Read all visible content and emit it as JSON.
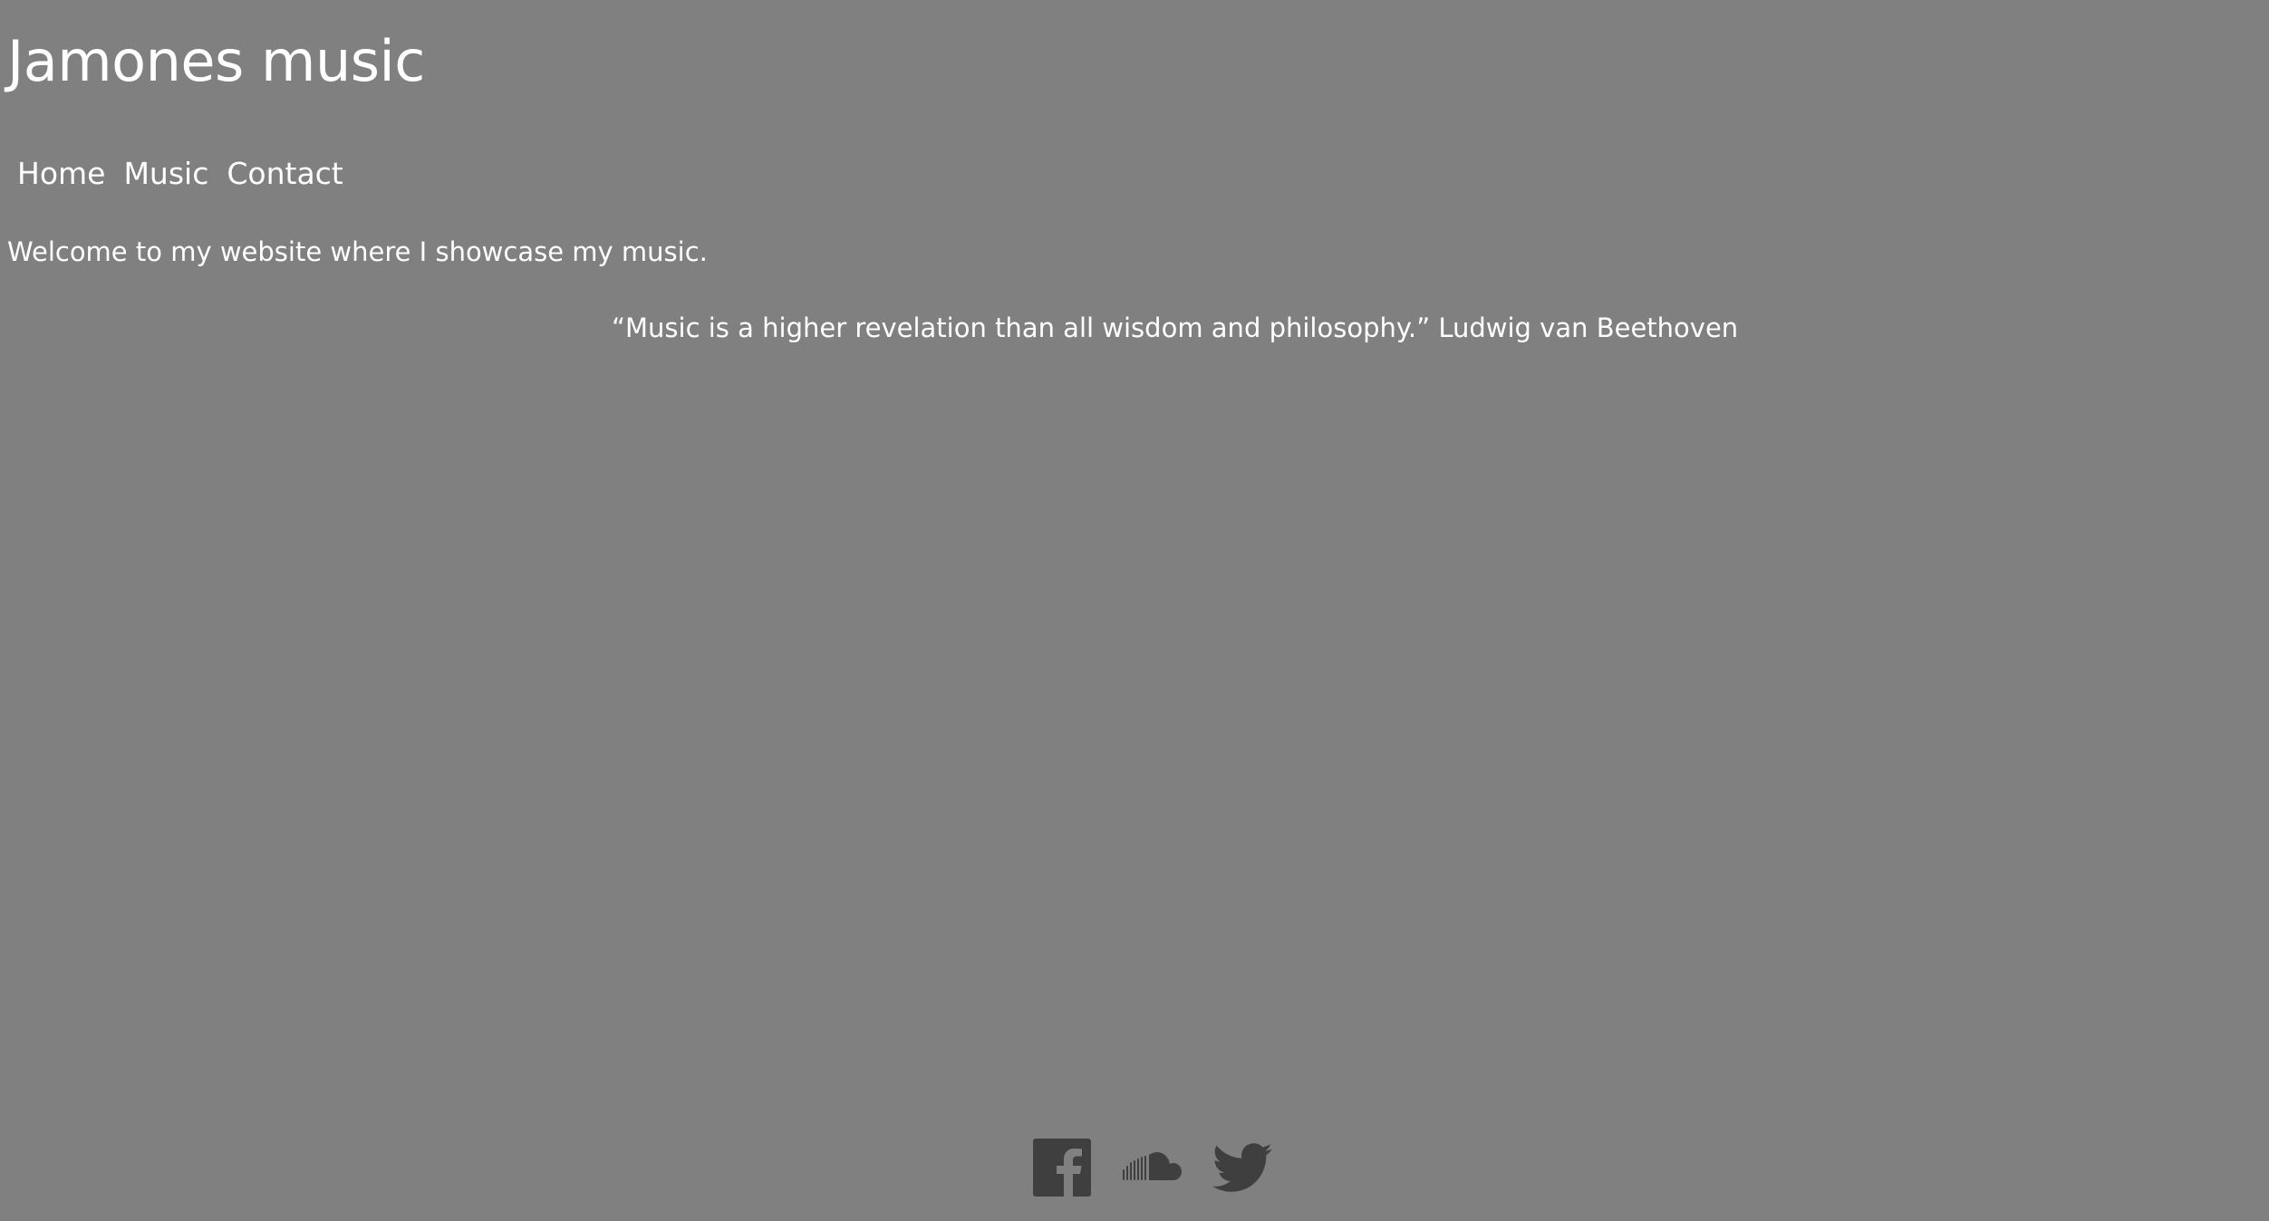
{
  "site": {
    "title": "Jamones music"
  },
  "nav": {
    "items": [
      {
        "label": "Home"
      },
      {
        "label": "Music"
      },
      {
        "label": "Contact"
      }
    ]
  },
  "content": {
    "welcome": "Welcome to my website where I showcase my music.",
    "quote": "“Music is a higher revelation than all wisdom and philosophy.” Ludwig van Beethoven"
  },
  "social": {
    "icons": [
      "facebook-icon",
      "soundcloud-icon",
      "twitter-icon"
    ],
    "icon_color": "#3f3f3f"
  },
  "colors": {
    "background": "#808080",
    "text": "#ffffff"
  }
}
